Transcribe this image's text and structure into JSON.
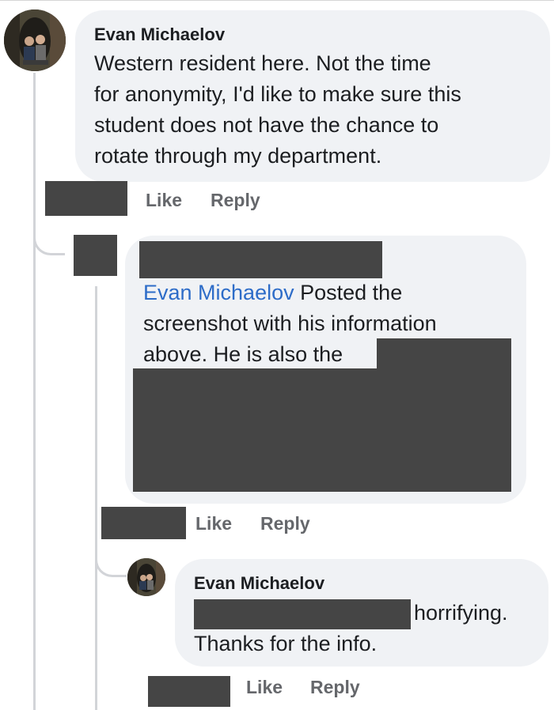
{
  "comments": [
    {
      "author": "Evan Michaelov",
      "lines": [
        "Western resident here. Not the time",
        "for anonymity, I'd like to make sure this",
        "student does not have the chance to",
        "rotate through my department."
      ],
      "like_label": "Like",
      "reply_label": "Reply"
    },
    {
      "mention": "Evan Michaelov",
      "line1_rest": " Posted the",
      "line2": "screenshot with his information",
      "line3": "above. He is also the",
      "like_label": "Like",
      "reply_label": "Reply"
    },
    {
      "author": "Evan Michaelov",
      "line1_rest": "horrifying.",
      "line2": "Thanks for the info.",
      "like_label": "Like",
      "reply_label": "Reply"
    }
  ],
  "colors": {
    "bubble": "#f0f2f5",
    "mention": "#2d6cc8",
    "action": "#65676b",
    "redaction": "#454545",
    "thread": "#d2d4d8"
  },
  "icons": {
    "avatar": "profile-photo"
  }
}
